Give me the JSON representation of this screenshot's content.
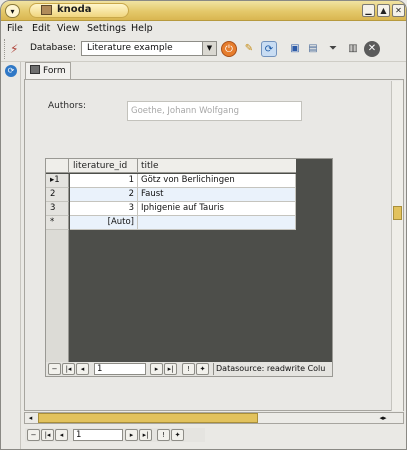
{
  "window": {
    "title": "knoda"
  },
  "menu": {
    "items": [
      "File",
      "Edit",
      "View",
      "Settings",
      "Help"
    ]
  },
  "toolbar": {
    "database_label": "Database:",
    "database_value": "Literature example"
  },
  "tab": {
    "label": "Form"
  },
  "form": {
    "authors_label": "Authors:",
    "authors_value": "Goethe, Johann Wolfgang"
  },
  "grid": {
    "columns": [
      "literature_id",
      "title"
    ],
    "rows": [
      {
        "marker": "▸1",
        "id": "1",
        "title": "Götz von Berlichingen"
      },
      {
        "marker": "2",
        "id": "2",
        "title": "Faust"
      },
      {
        "marker": "3",
        "id": "3",
        "title": "Iphigenie auf Tauris"
      },
      {
        "marker": "*",
        "id": "[Auto]",
        "title": ""
      }
    ],
    "navigator": {
      "record": "1",
      "status": "Datasource: readwrite Colu"
    }
  },
  "form_navigator": {
    "record": "1"
  },
  "colors": {
    "titlebar": "#e4c86a",
    "grid_background": "#4d4e4a",
    "row_highlight": "#eaf2fb"
  }
}
